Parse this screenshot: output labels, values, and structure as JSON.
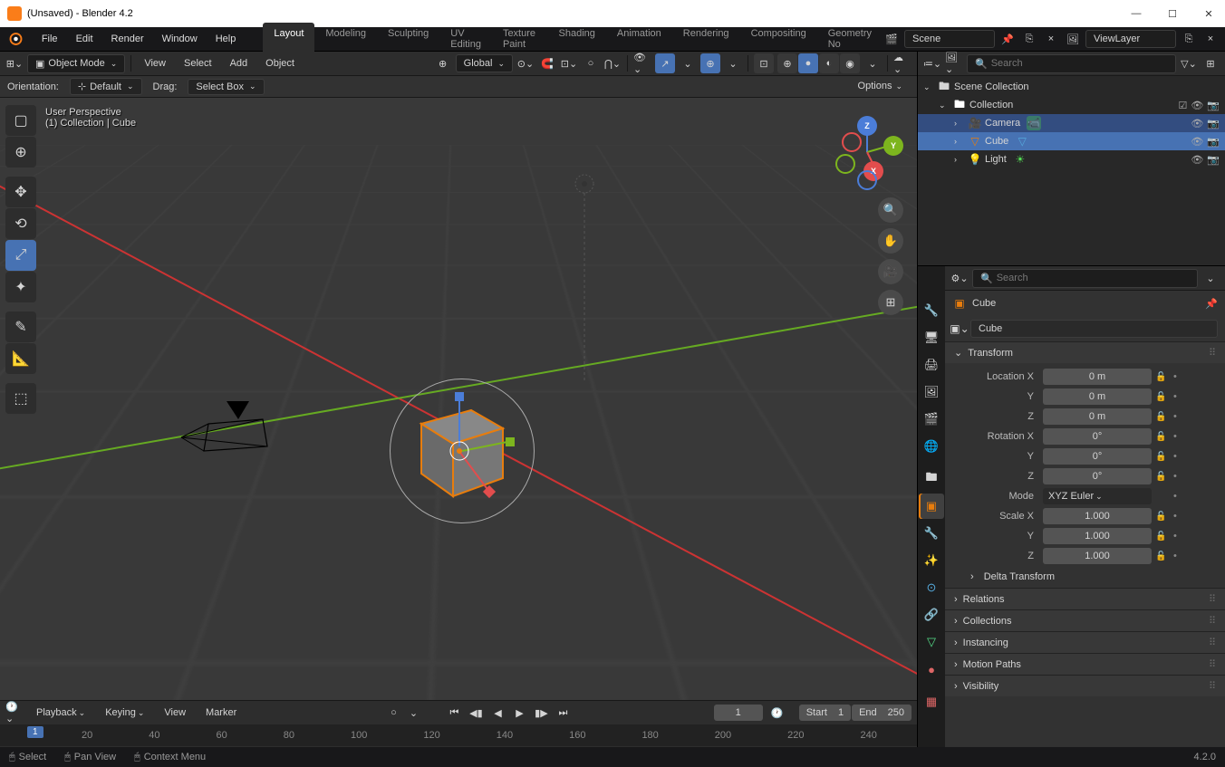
{
  "title": "(Unsaved) - Blender 4.2",
  "menus": [
    "File",
    "Edit",
    "Render",
    "Window",
    "Help"
  ],
  "workspaces": [
    "Layout",
    "Modeling",
    "Sculpting",
    "UV Editing",
    "Texture Paint",
    "Shading",
    "Animation",
    "Rendering",
    "Compositing",
    "Geometry No"
  ],
  "active_workspace": 0,
  "scene": {
    "name": "Scene",
    "layer": "ViewLayer"
  },
  "viewport": {
    "mode": "Object Mode",
    "header_items": [
      "View",
      "Select",
      "Add",
      "Object"
    ],
    "orientation": "Global",
    "sub": {
      "orientation_label": "Orientation:",
      "orientation": "Default",
      "drag_label": "Drag:",
      "drag": "Select Box"
    },
    "options": "Options",
    "info_line1": "User Perspective",
    "info_line2": "(1) Collection | Cube"
  },
  "outliner": {
    "search_placeholder": "Search",
    "root": "Scene Collection",
    "collection": "Collection",
    "items": [
      {
        "name": "Camera",
        "icon": "🎥",
        "color": "#e87d0d"
      },
      {
        "name": "Cube",
        "icon": "▽",
        "color": "#e87d0d",
        "selected": true
      },
      {
        "name": "Light",
        "icon": "💡",
        "color": "#e8b40d"
      }
    ]
  },
  "properties": {
    "search_placeholder": "Search",
    "object_name": "Cube",
    "transform": {
      "title": "Transform",
      "location": {
        "label": "Location",
        "x": "0 m",
        "y": "0 m",
        "z": "0 m"
      },
      "rotation": {
        "label": "Rotation",
        "x": "0°",
        "y": "0°",
        "z": "0°"
      },
      "mode_label": "Mode",
      "mode": "XYZ Euler",
      "scale": {
        "label": "Scale",
        "x": "1.000",
        "y": "1.000",
        "z": "1.000"
      },
      "delta": "Delta Transform"
    },
    "sections": [
      "Relations",
      "Collections",
      "Instancing",
      "Motion Paths",
      "Visibility"
    ]
  },
  "timeline": {
    "menus": [
      "Playback",
      "Keying",
      "View",
      "Marker"
    ],
    "current": "1",
    "start_label": "Start",
    "start": "1",
    "end_label": "End",
    "end": "250",
    "ticks": [
      "20",
      "40",
      "60",
      "80",
      "100",
      "120",
      "140",
      "160",
      "180",
      "200",
      "220",
      "240"
    ]
  },
  "statusbar": {
    "select": "Select",
    "pan": "Pan View",
    "context": "Context Menu",
    "version": "4.2.0"
  }
}
